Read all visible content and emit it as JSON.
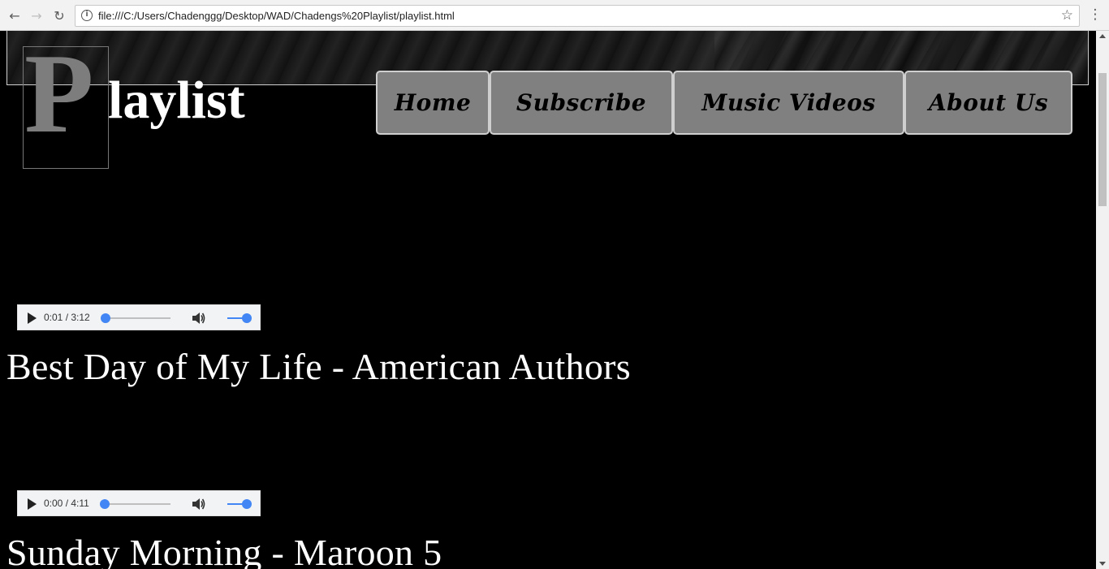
{
  "browser": {
    "url": "file:///C:/Users/Chadenggg/Desktop/WAD/Chadengs%20Playlist/playlist.html",
    "back_icon": "arrow-left-icon",
    "forward_icon": "arrow-right-icon",
    "reload_icon": "reload-icon",
    "info_icon": "info-icon",
    "bookmark_icon": "star-icon",
    "menu_icon": "vertical-dots-icon"
  },
  "logo": {
    "initial": "P",
    "rest": "laylist"
  },
  "nav": {
    "items": [
      {
        "label": "Home"
      },
      {
        "label": "Subscribe"
      },
      {
        "label": "Music Videos"
      },
      {
        "label": "About Us"
      }
    ]
  },
  "tracks": [
    {
      "time": "0:01 / 3:12",
      "progress": 0.005,
      "title": "Best Day of My Life - American Authors"
    },
    {
      "time": "0:00 / 4:11",
      "progress": 0.0,
      "title": "Sunday Morning - Maroon 5"
    }
  ],
  "colors": {
    "page_bg": "#000000",
    "nav_button_bg": "#808080",
    "accent": "#4285f4"
  }
}
